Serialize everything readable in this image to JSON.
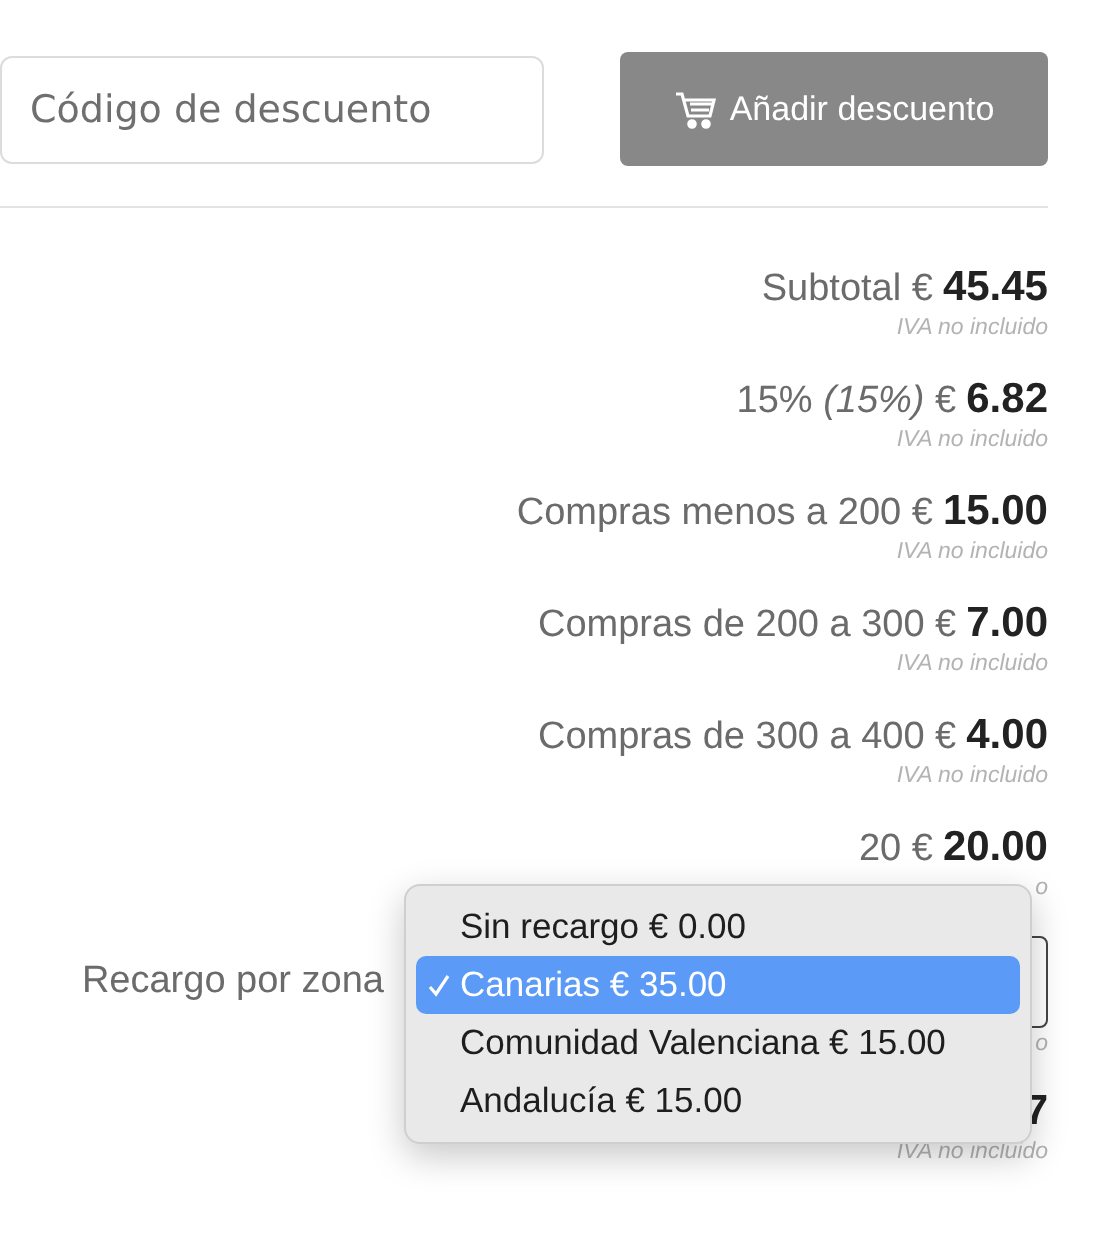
{
  "discount": {
    "placeholder": "Código de descuento",
    "button": "Añadir descuento"
  },
  "totals": [
    {
      "label": "Subtotal €",
      "amount": "45.45",
      "note": "IVA no incluido"
    },
    {
      "label": "15% *(15%)* €",
      "amount": "6.82",
      "note": "IVA no incluido"
    },
    {
      "label": "Compras menos a 200 €",
      "amount": "15.00",
      "note": "IVA no incluido"
    },
    {
      "label": "Compras de 200 a 300 €",
      "amount": "7.00",
      "note": "IVA no incluido"
    },
    {
      "label": "Compras de 300 a 400 €",
      "amount": "4.00",
      "note": "IVA no incluido"
    },
    {
      "label": "20 €",
      "amount": "20.00",
      "note": "o"
    }
  ],
  "zone": {
    "label": "Recargo por zona",
    "note": "o",
    "options": [
      {
        "label": "Sin recargo € 0.00",
        "selected": false
      },
      {
        "label": "Canarias € 35.00",
        "selected": true
      },
      {
        "label": "Comunidad Valenciana € 15.00",
        "selected": false
      },
      {
        "label": "Andalucía € 15.00",
        "selected": false
      }
    ]
  },
  "total": {
    "amount": "7",
    "note": "IVA no incluido"
  }
}
